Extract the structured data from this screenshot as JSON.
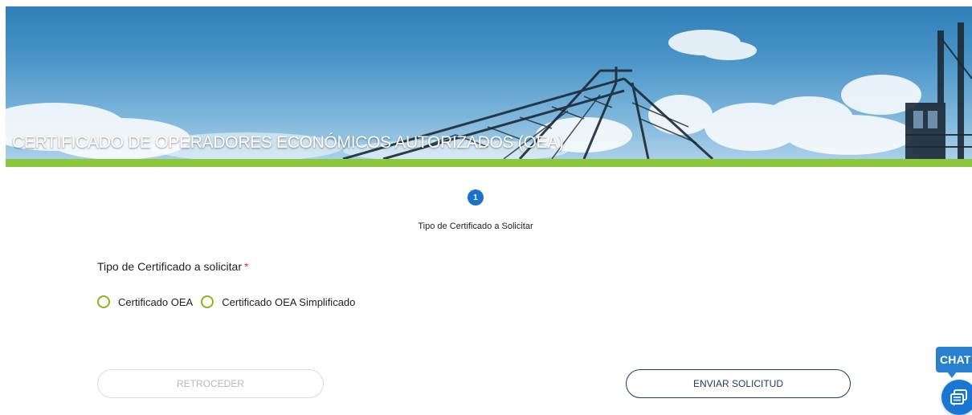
{
  "banner": {
    "title": "CERTIFICADO DE OPERADORES ECONÓMICOS AUTORIZADOS (OEA)"
  },
  "stepper": {
    "steps": [
      {
        "number": "1",
        "label": "Tipo de Certificado a Solicitar",
        "active": true
      }
    ]
  },
  "form": {
    "certificate_type": {
      "label": "Tipo de Certificado a solicitar",
      "required_mark": "*",
      "options": [
        {
          "label": "Certificado OEA",
          "selected": false
        },
        {
          "label": "Certificado OEA Simplificado",
          "selected": false
        }
      ]
    }
  },
  "actions": {
    "back_label": "RETROCEDER",
    "back_enabled": false,
    "submit_label": "ENVIAR SOLICITUD"
  },
  "chat": {
    "label": "CHAT!",
    "icon": "chat-icon"
  },
  "colors": {
    "accent_green": "#8dc63f",
    "radio_border": "#8db321",
    "step_active": "#1b73c9",
    "button_dark": "#1f3a5c",
    "required": "#e23b3b",
    "chat_blue": "#2a80d0"
  }
}
